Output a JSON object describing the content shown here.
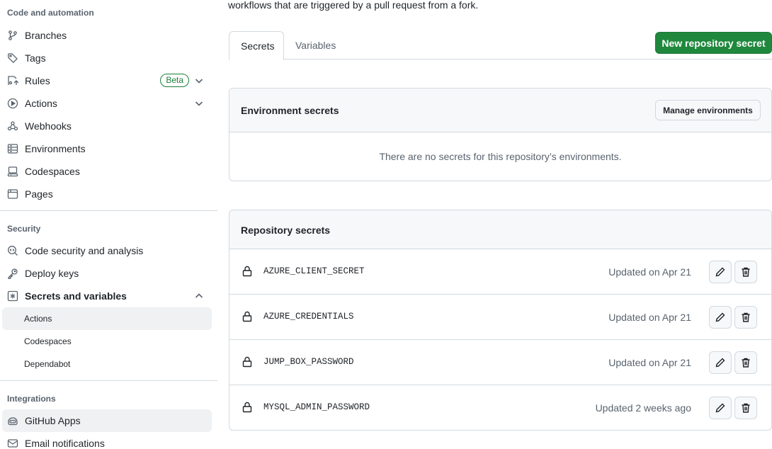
{
  "sidebar": {
    "code_heading": "Code and automation",
    "code_items": [
      {
        "label": "Branches",
        "icon": "branch-icon"
      },
      {
        "label": "Tags",
        "icon": "tag-icon"
      },
      {
        "label": "Rules",
        "icon": "rules-icon",
        "badge": "Beta"
      },
      {
        "label": "Actions",
        "icon": "play-icon"
      },
      {
        "label": "Webhooks",
        "icon": "webhook-icon"
      },
      {
        "label": "Environments",
        "icon": "server-icon"
      },
      {
        "label": "Codespaces",
        "icon": "codespaces-icon"
      },
      {
        "label": "Pages",
        "icon": "browser-icon"
      }
    ],
    "security_heading": "Security",
    "security_items": [
      {
        "label": "Code security and analysis",
        "icon": "codescan-icon"
      },
      {
        "label": "Deploy keys",
        "icon": "key-icon"
      },
      {
        "label": "Secrets and variables",
        "icon": "asterisk-icon"
      }
    ],
    "secrets_subitems": [
      "Actions",
      "Codespaces",
      "Dependabot"
    ],
    "integrations_heading": "Integrations",
    "integrations_items": [
      {
        "label": "GitHub Apps",
        "icon": "apps-icon"
      },
      {
        "label": "Email notifications",
        "icon": "mail-icon"
      }
    ]
  },
  "main": {
    "intro": "workflows that are triggered by a pull request from a fork.",
    "tabs": [
      "Secrets",
      "Variables"
    ],
    "new_secret_button": "New repository secret",
    "environment_secrets": {
      "title": "Environment secrets",
      "manage_button": "Manage environments",
      "empty_message": "There are no secrets for this repository’s environments."
    },
    "repository_secrets": {
      "title": "Repository secrets",
      "rows": [
        {
          "name": "AZURE_CLIENT_SECRET",
          "updated": "Updated on Apr 21"
        },
        {
          "name": "AZURE_CREDENTIALS",
          "updated": "Updated on Apr 21"
        },
        {
          "name": "JUMP_BOX_PASSWORD",
          "updated": "Updated on Apr 21"
        },
        {
          "name": "MYSQL_ADMIN_PASSWORD",
          "updated": "Updated 2 weeks ago"
        }
      ]
    }
  },
  "colors": {
    "accent_green": "#1f883d",
    "badge_green": "#1a7f37",
    "muted_text": "#59636e",
    "border": "#d1d9e0"
  }
}
